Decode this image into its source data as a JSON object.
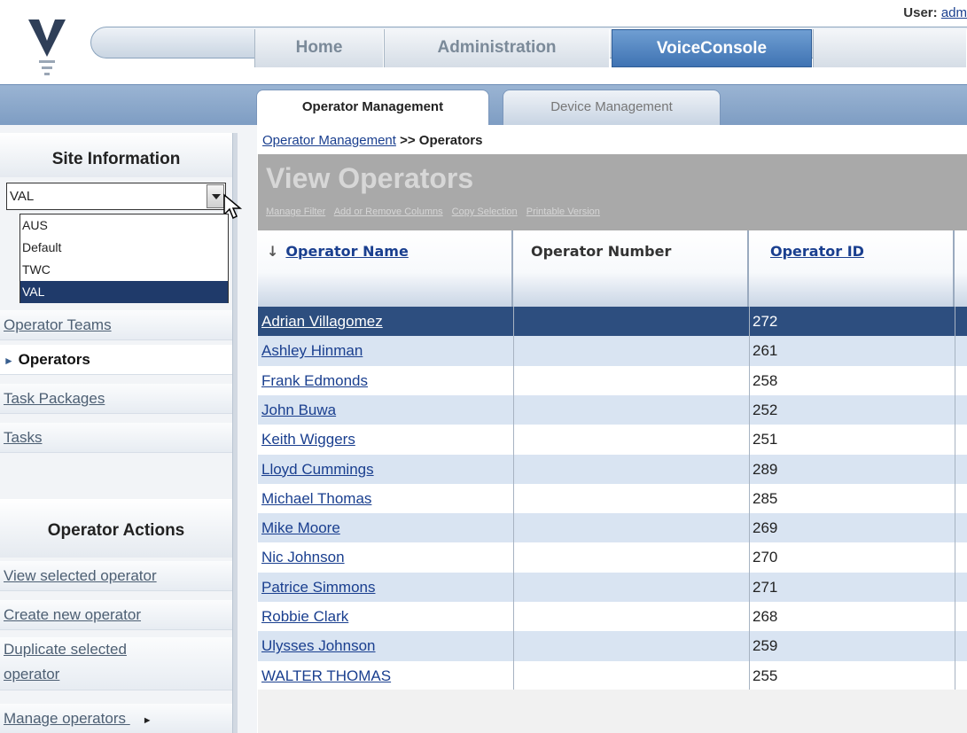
{
  "header": {
    "user_label": "User:",
    "user_name": "adm",
    "tabs": [
      {
        "label": "Home"
      },
      {
        "label": "Administration"
      },
      {
        "label": "VoiceConsole"
      }
    ]
  },
  "subtabs": [
    {
      "label": "Operator Management"
    },
    {
      "label": "Device Management"
    }
  ],
  "sidebar": {
    "site_title": "Site Information",
    "site_select": {
      "value": "VAL",
      "options": [
        "AUS",
        "Default",
        "TWC",
        "VAL"
      ]
    },
    "nav": [
      {
        "label": "Operator Teams"
      },
      {
        "label": "Operators"
      },
      {
        "label": "Task Packages"
      },
      {
        "label": "Tasks"
      }
    ],
    "actions_title": "Operator Actions",
    "actions": [
      {
        "label": "View selected operator"
      },
      {
        "label": "Create new operator"
      },
      {
        "label": "Duplicate selected"
      },
      {
        "label": "operator"
      },
      {
        "label": "Manage operators"
      }
    ]
  },
  "main": {
    "breadcrumb_link": "Operator Management",
    "breadcrumb_rest": ">> Operators",
    "title": "View Operators",
    "actions": [
      "Manage Filter",
      "Add or Remove Columns",
      "Copy Selection",
      "Printable Version"
    ],
    "columns": [
      "Operator Name",
      "Operator Number",
      "Operator ID"
    ],
    "rows": [
      {
        "name": "Adrian Villagomez",
        "id": "272"
      },
      {
        "name": "Ashley Hinman",
        "id": "261"
      },
      {
        "name": "Frank Edmonds",
        "id": "258"
      },
      {
        "name": "John Buwa",
        "id": "252"
      },
      {
        "name": "Keith Wiggers",
        "id": "251"
      },
      {
        "name": "Lloyd Cummings",
        "id": "289"
      },
      {
        "name": "Michael Thomas",
        "id": "285"
      },
      {
        "name": "Mike Moore",
        "id": "269"
      },
      {
        "name": "Nic Johnson",
        "id": "270"
      },
      {
        "name": "Patrice Simmons",
        "id": "271"
      },
      {
        "name": "Robbie Clark",
        "id": "268"
      },
      {
        "name": "Ulysses Johnson",
        "id": "259"
      },
      {
        "name": "WALTER THOMAS",
        "id": "255"
      }
    ]
  }
}
